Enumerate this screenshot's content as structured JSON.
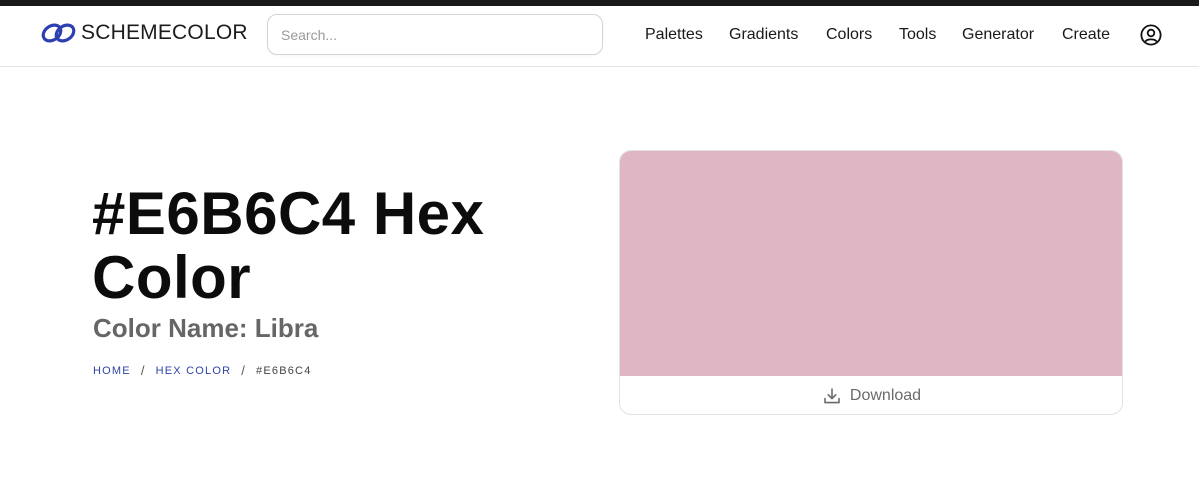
{
  "header": {
    "logo_text": "SCHEMECOLOR",
    "logo_icon": "infinity-rings-icon",
    "search_placeholder": "Search...",
    "nav": [
      {
        "label": "Palettes"
      },
      {
        "label": "Gradients"
      },
      {
        "label": "Colors"
      },
      {
        "label": "Tools"
      },
      {
        "label": "Generator"
      },
      {
        "label": "Create"
      }
    ],
    "account_icon": "user-circle-icon"
  },
  "hero": {
    "title": "#E6B6C4 Hex Color",
    "color_name": "Color Name: Libra"
  },
  "breadcrumb": {
    "home": "HOME",
    "section": "HEX COLOR",
    "current": "#E6B6C4"
  },
  "preview": {
    "swatch_color": "#DFB7C4",
    "download_label": "Download",
    "download_icon": "download-icon"
  },
  "colors": {
    "brand_blue": "#2E3FB0",
    "link_blue": "#3243A8"
  }
}
